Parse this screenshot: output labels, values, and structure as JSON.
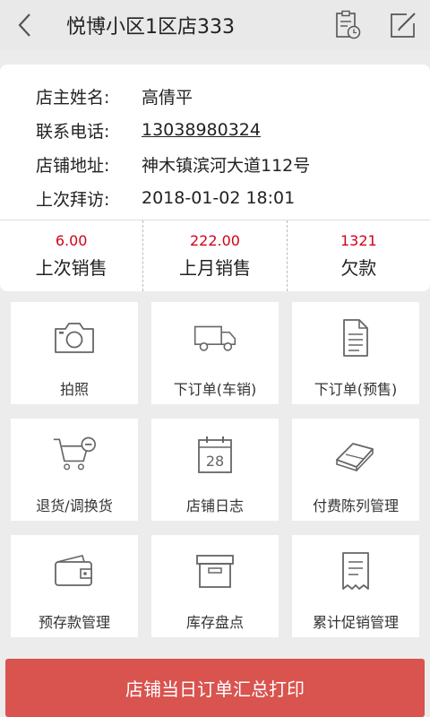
{
  "header": {
    "title": "悦博小区1区店333",
    "back_icon": "chevron-left-icon",
    "visit_icon": "clipboard-clock-icon",
    "edit_icon": "edit-icon"
  },
  "store_info": {
    "owner_label": "店主姓名:",
    "owner_value": "高倩平",
    "phone_label": "联系电话:",
    "phone_value": "13038980324",
    "address_label": "店铺地址:",
    "address_value": "神木镇滨河大道112号",
    "last_visit_label": "上次拜访:",
    "last_visit_value": "2018-01-02 18:01"
  },
  "stats": [
    {
      "value": "6.00",
      "label": "上次销售"
    },
    {
      "value": "222.00",
      "label": "上月销售"
    },
    {
      "value": "1321",
      "label": "欠款"
    }
  ],
  "actions": [
    {
      "label": "拍照",
      "icon": "camera-icon"
    },
    {
      "label": "下订单(车销)",
      "icon": "truck-icon"
    },
    {
      "label": "下订单(预售)",
      "icon": "document-icon"
    },
    {
      "label": "退货/调换货",
      "icon": "cart-minus-icon"
    },
    {
      "label": "店铺日志",
      "icon": "calendar-icon"
    },
    {
      "label": "付费陈列管理",
      "icon": "books-icon"
    },
    {
      "label": "预存款管理",
      "icon": "wallet-icon"
    },
    {
      "label": "库存盘点",
      "icon": "box-icon"
    },
    {
      "label": "累计促销管理",
      "icon": "receipt-icon"
    }
  ],
  "print_button": {
    "label": "店铺当日订单汇总打印"
  },
  "colors": {
    "accent_red": "#d0021b",
    "button_red": "#d9534f",
    "icon_gray": "#666666"
  }
}
